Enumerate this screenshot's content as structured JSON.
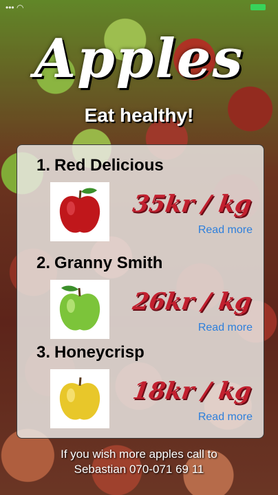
{
  "header": {
    "title": "Apples",
    "subtitle": "Eat healthy!"
  },
  "apples": [
    {
      "number": "1.",
      "name": "Red Delicious",
      "price": "35kr / kg",
      "read_more": "Read more",
      "color": "#c0171b"
    },
    {
      "number": "2.",
      "name": "Granny Smith",
      "price": "26kr / kg",
      "read_more": "Read more",
      "color": "#7cc43a"
    },
    {
      "number": "3.",
      "name": "Honeycrisp",
      "price": "18kr / kg",
      "read_more": "Read more",
      "color": "#e8c72a"
    }
  ],
  "footer": {
    "line1": "If you wish more apples call to",
    "line2": "Sebastian 070-071 69 11"
  },
  "colors": {
    "price": "#c2202f",
    "link": "#2d7fdc",
    "battery": "#38d35a"
  }
}
